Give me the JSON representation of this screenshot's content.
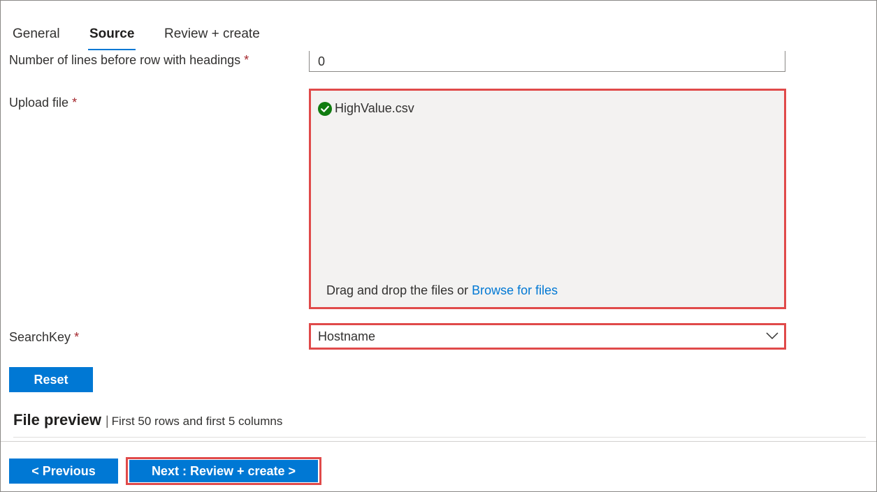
{
  "tabs": [
    {
      "label": "General"
    },
    {
      "label": "Source"
    },
    {
      "label": "Review + create"
    }
  ],
  "form": {
    "lines_label": "Number of lines before row with headings",
    "lines_value": "0",
    "upload_label": "Upload file",
    "uploaded_file": "HighValue.csv",
    "drop_text": "Drag and drop the files or ",
    "browse_link": "Browse for files",
    "searchkey_label": "SearchKey",
    "searchkey_value": "Hostname",
    "required_marker": "*"
  },
  "buttons": {
    "reset": "Reset",
    "previous": "< Previous",
    "next": "Next : Review + create >"
  },
  "preview": {
    "title": "File preview",
    "separator": "|",
    "subtitle": "First 50 rows and first 5 columns"
  },
  "colors": {
    "accent": "#0078d4",
    "highlight": "#e04a4a",
    "success": "#107c10",
    "required": "#a4262c"
  },
  "icons": {
    "success": "check-circle-icon",
    "dropdown": "chevron-down-icon"
  }
}
